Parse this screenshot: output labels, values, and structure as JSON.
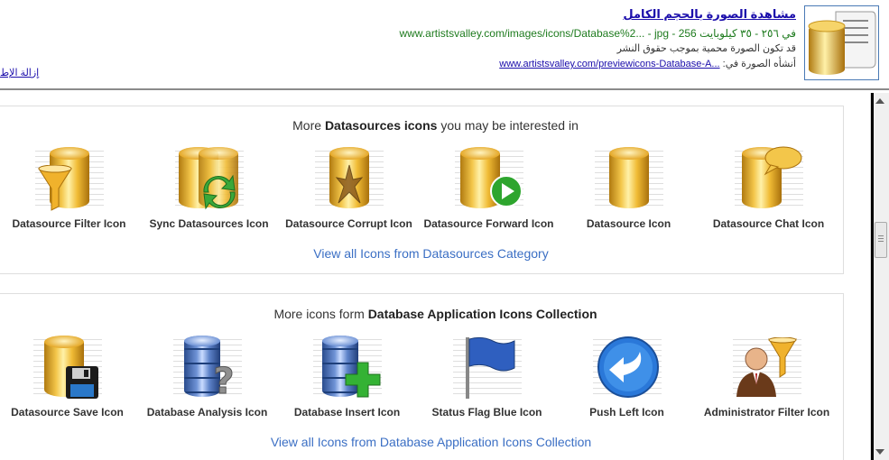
{
  "header": {
    "title": "مشاهدة الصورة بالحجم الكامل",
    "url_line": "www.artistsvalley.com/images/icons/Database%2... - jpg - 256 ‏في ٢٥٦ - ٣٥ كيلوبايت",
    "copyright_note": "قد تكون الصورة محمية بموجب حقوق النشر",
    "page_label": "‏أنشأه الصورة في:",
    "page_link": "www.artistsvalley.com/previewicons-Database-A...",
    "remove_link": "إزالة الإط"
  },
  "panel1": {
    "heading_prefix": "More ",
    "heading_bold": "Datasources icons",
    "heading_suffix": " you may be interested in",
    "icons": [
      {
        "label": "Datasource Filter Icon",
        "icon": "datasource-filter-icon"
      },
      {
        "label": "Sync Datasources Icon",
        "icon": "sync-datasources-icon"
      },
      {
        "label": "Datasource Corrupt Icon",
        "icon": "datasource-corrupt-icon"
      },
      {
        "label": "Datasource Forward Icon",
        "icon": "datasource-forward-icon"
      },
      {
        "label": "Datasource Icon",
        "icon": "datasource-icon"
      },
      {
        "label": "Datasource Chat Icon",
        "icon": "datasource-chat-icon"
      }
    ],
    "view_all": "View all Icons from Datasources Category"
  },
  "panel2": {
    "heading_prefix": "More icons form ",
    "heading_bold": "Database Application Icons Collection",
    "heading_suffix": "",
    "icons": [
      {
        "label": "Datasource Save Icon",
        "icon": "datasource-save-icon"
      },
      {
        "label": "Database Analysis Icon",
        "icon": "database-analysis-icon"
      },
      {
        "label": "Database Insert Icon",
        "icon": "database-insert-icon"
      },
      {
        "label": "Status Flag Blue Icon",
        "icon": "status-flag-blue-icon"
      },
      {
        "label": "Push Left Icon",
        "icon": "push-left-icon"
      },
      {
        "label": "Administrator Filter Icon",
        "icon": "administrator-filter-icon"
      }
    ],
    "view_all": "View all Icons from Database Application Icons Collection"
  },
  "colors": {
    "link": "#1a0dab",
    "url_green": "#1e7b1e",
    "view_all_blue": "#3b6fc4",
    "gold": "#f0bb35",
    "db_blue": "#5d82c9"
  }
}
